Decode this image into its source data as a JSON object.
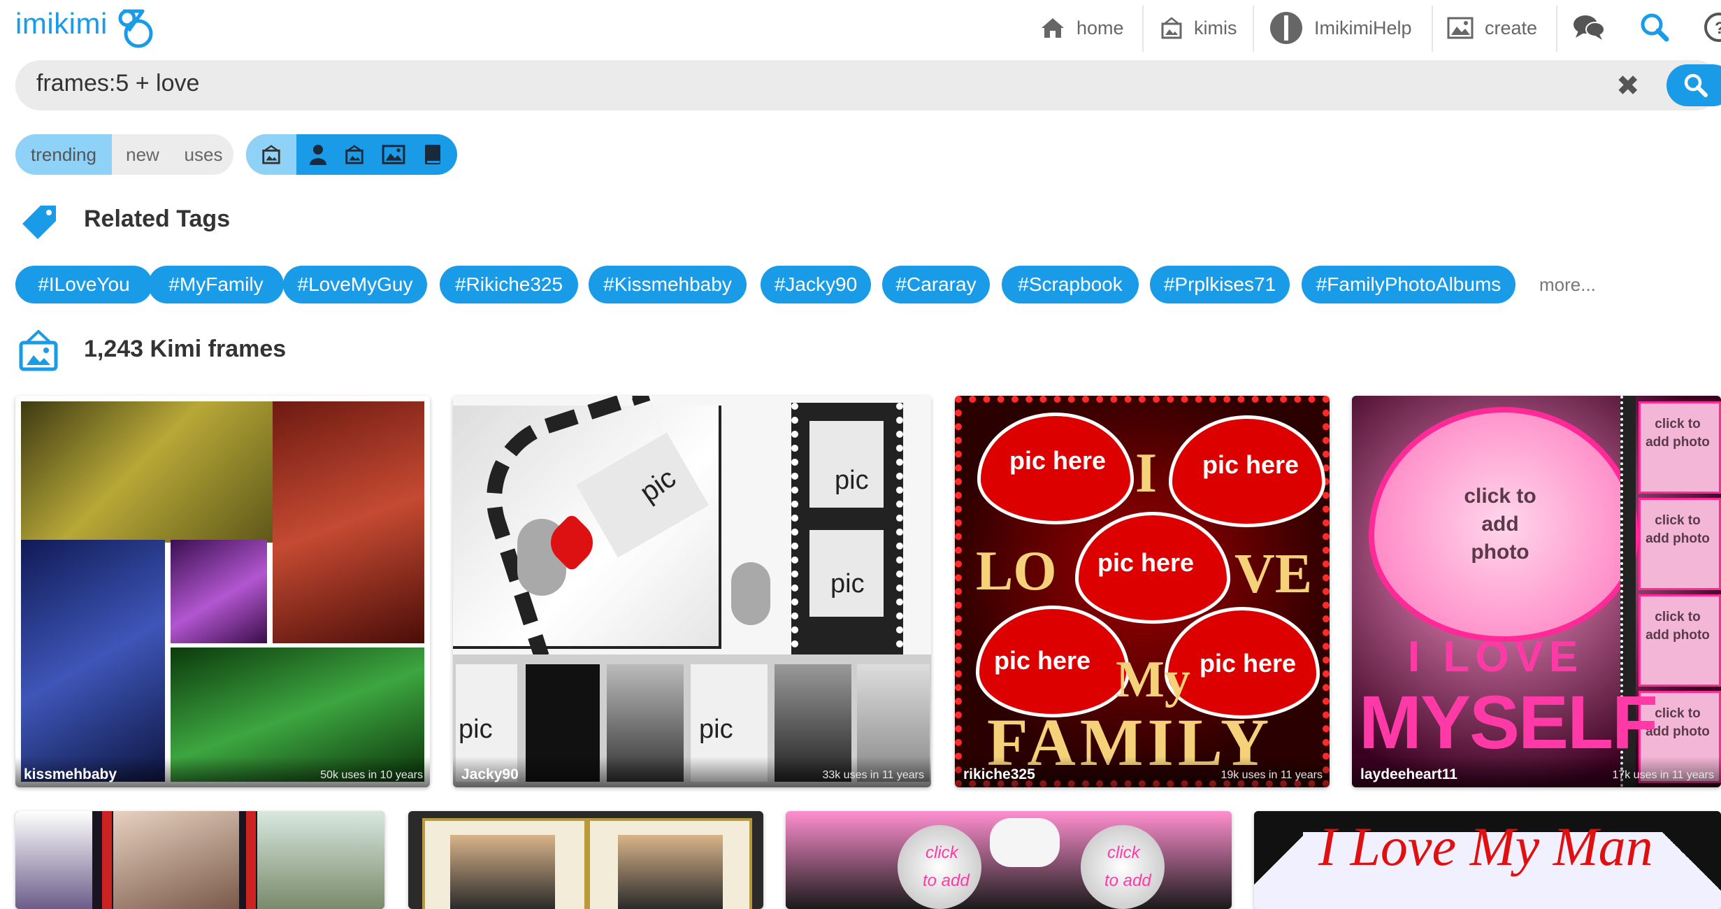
{
  "app": {
    "logo_text": "imikimi"
  },
  "nav": {
    "items": [
      {
        "label": "home",
        "icon": "home-icon"
      },
      {
        "label": "kimis",
        "icon": "frame-icon"
      },
      {
        "label": "ImikimiHelp",
        "icon": "user-avatar-icon"
      },
      {
        "label": "create",
        "icon": "image-icon"
      }
    ],
    "extra_icons": [
      "chat-icon",
      "search-icon",
      "help-icon"
    ]
  },
  "search": {
    "value": "frames:5 + love",
    "clear_symbol": "✖"
  },
  "sort_tabs": [
    {
      "label": "trending",
      "active": true
    },
    {
      "label": "new",
      "active": false
    },
    {
      "label": "uses",
      "active": false
    }
  ],
  "type_filters": [
    "frame-icon",
    "user-icon",
    "frame-icon",
    "image-icon",
    "book-icon"
  ],
  "related": {
    "title": "Related Tags",
    "tags": [
      "#ILoveYou",
      "#MyFamily",
      "#LoveMyGuy",
      "#Rikiche325",
      "#Kissmehbaby",
      "#Jacky90",
      "#Cararay",
      "#Scrapbook",
      "#Prplkises71",
      "#FamilyPhotoAlbums"
    ],
    "more_label": "more..."
  },
  "results": {
    "count_label": "1,243 Kimi frames",
    "cards": [
      {
        "author": "kissmehbaby",
        "uses": "50k uses in 10 years"
      },
      {
        "author": "Jacky90",
        "uses": "33k uses in 11 years",
        "labels": [
          "pic",
          "pic",
          "pic",
          "pic",
          "pic"
        ]
      },
      {
        "author": "rikiche325",
        "uses": "19k uses in 11 years",
        "labels": [
          "pic here",
          "pic here",
          "pic here",
          "pic here",
          "pic here"
        ],
        "big_letters": [
          "I",
          "LO",
          "VE",
          "My",
          "FAMILY"
        ]
      },
      {
        "author": "laydeeheart11",
        "uses": "17k uses in 11 years",
        "labels": [
          "click to add photo",
          "click to add photo",
          "click to add photo",
          "click to add photo",
          "click to add photo"
        ],
        "big_text": [
          "I LOVE",
          "MYSELF"
        ]
      }
    ],
    "row2": [
      {
        "name": "couple-frame"
      },
      {
        "name": "book-frame"
      },
      {
        "name": "pink-circles-frame",
        "labels": [
          "click",
          "to add",
          "click",
          "to add"
        ]
      },
      {
        "name": "star-frame",
        "title_text": "I Love My Man"
      }
    ]
  },
  "colors": {
    "accent": "#1a9be8",
    "accent_light": "#8fd2f7",
    "search_bg": "#ebebeb"
  }
}
